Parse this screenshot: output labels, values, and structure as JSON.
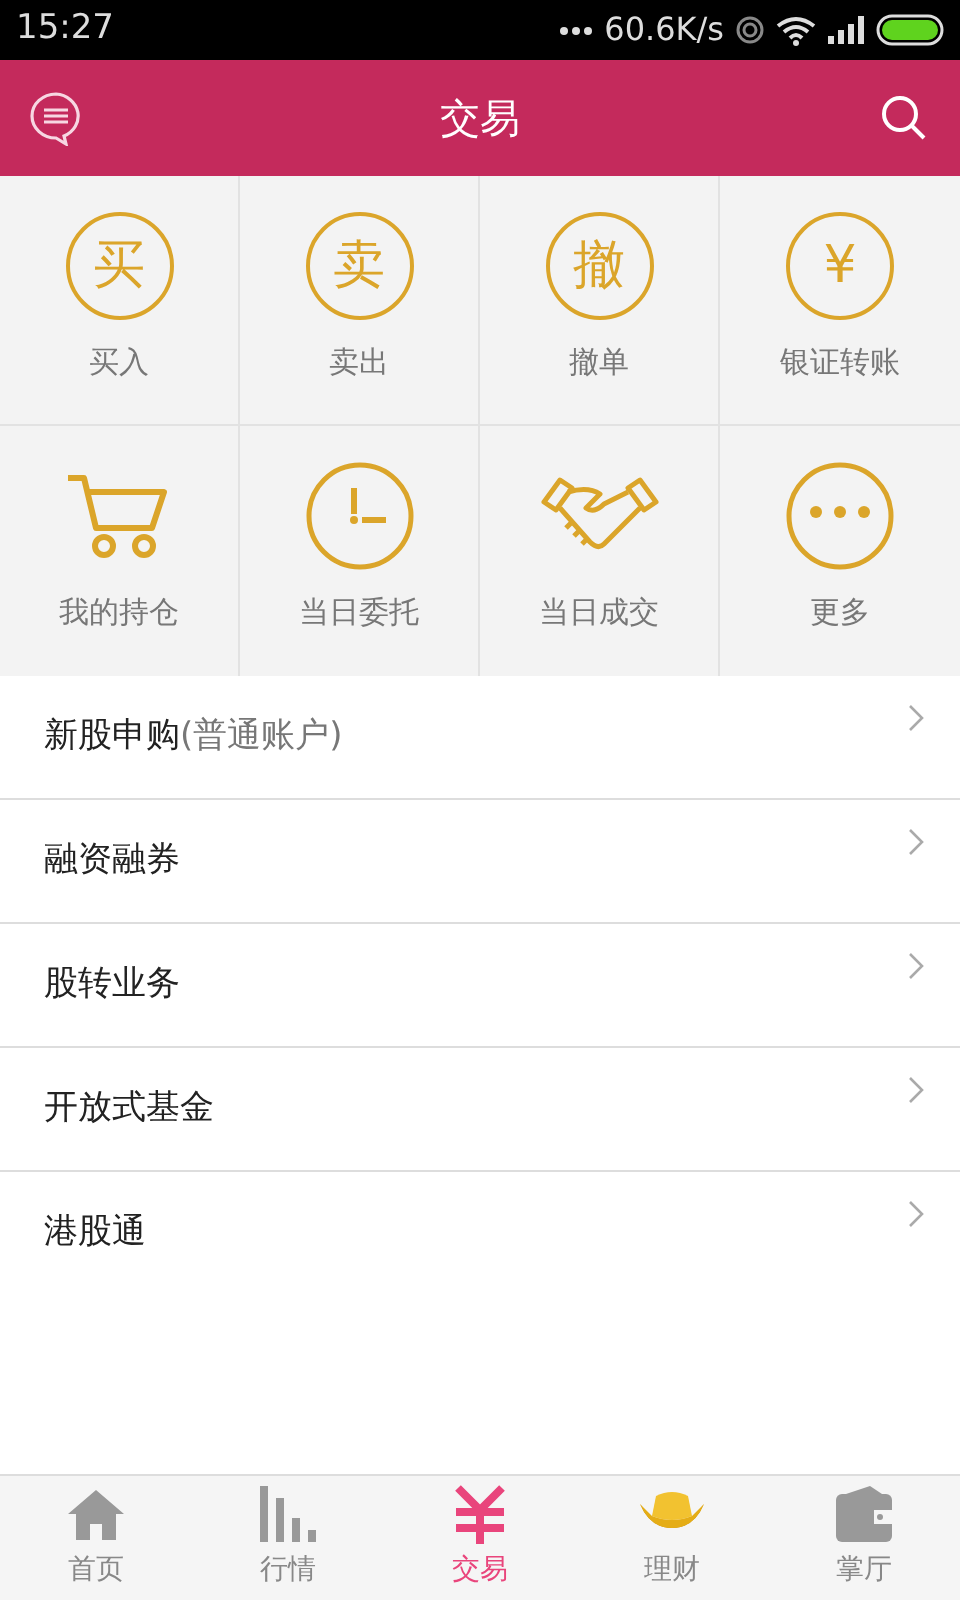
{
  "status_bar": {
    "time": "15:27",
    "network_speed": "60.6K/s"
  },
  "header": {
    "title": "交易"
  },
  "grid": [
    {
      "kind": "glyph",
      "glyph": "买",
      "label": "买入"
    },
    {
      "kind": "glyph",
      "glyph": "卖",
      "label": "卖出"
    },
    {
      "kind": "glyph",
      "glyph": "撤",
      "label": "撤单"
    },
    {
      "kind": "glyph",
      "glyph": "¥",
      "label": "银证转账"
    },
    {
      "kind": "cart",
      "label": "我的持仓"
    },
    {
      "kind": "clock",
      "label": "当日委托"
    },
    {
      "kind": "handshake",
      "label": "当日成交"
    },
    {
      "kind": "more",
      "label": "更多"
    }
  ],
  "menu": [
    {
      "label": "新股申购",
      "note": "(普通账户)"
    },
    {
      "label": "融资融券"
    },
    {
      "label": "股转业务"
    },
    {
      "label": "开放式基金"
    },
    {
      "label": "港股通"
    }
  ],
  "tab_bar": [
    {
      "kind": "home",
      "label": "首页",
      "selected": false
    },
    {
      "kind": "chart",
      "label": "行情",
      "selected": false
    },
    {
      "kind": "yen",
      "label": "交易",
      "selected": true
    },
    {
      "kind": "ingot",
      "label": "理财",
      "selected": false
    },
    {
      "kind": "wallet",
      "label": "掌厅",
      "selected": false
    }
  ]
}
